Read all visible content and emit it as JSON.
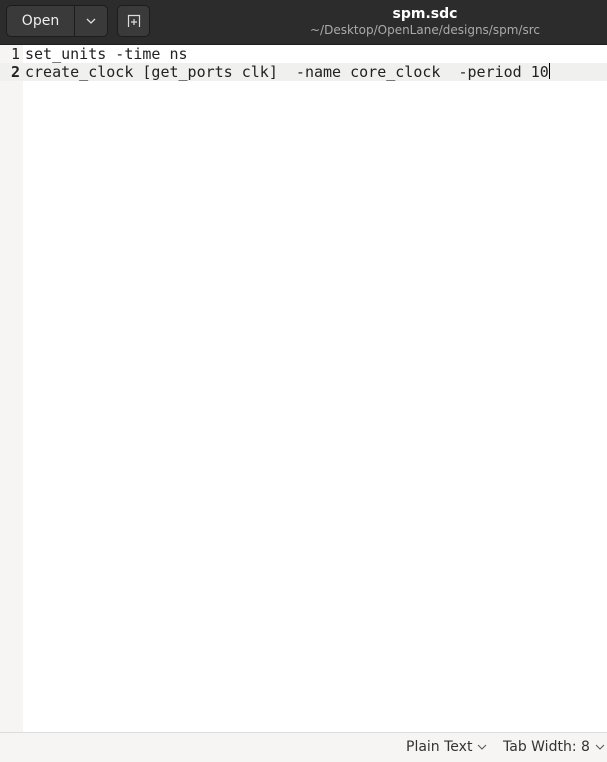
{
  "header": {
    "open_label": "Open",
    "title": "spm.sdc",
    "subtitle": "~/Desktop/OpenLane/designs/spm/src"
  },
  "editor": {
    "lines": [
      {
        "number": "1",
        "text": "set_units -time ns"
      },
      {
        "number": "2",
        "text": "create_clock [get_ports clk]  -name core_clock  -period 10"
      }
    ]
  },
  "status": {
    "language": "Plain Text",
    "tab_width": "Tab Width: 8"
  }
}
